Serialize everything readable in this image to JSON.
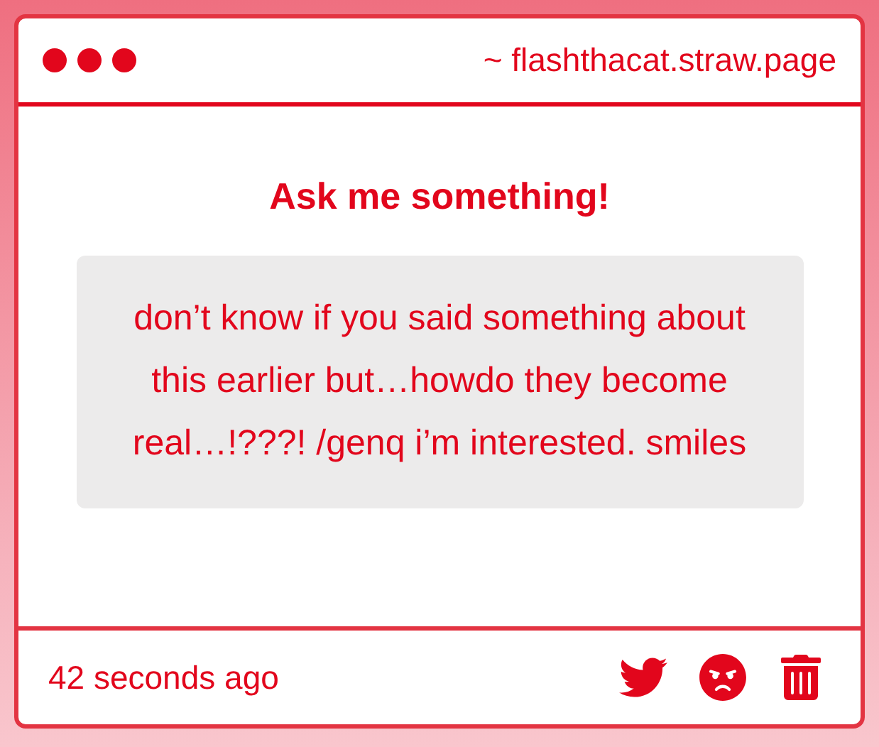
{
  "window": {
    "address": "~ flashthacat.straw.page"
  },
  "heading": "Ask me something!",
  "question": "don’t know if you said something about this earlier but…howdo they become real…!???! /genq i’m interested. smiles",
  "footer": {
    "time": "42 seconds ago"
  }
}
